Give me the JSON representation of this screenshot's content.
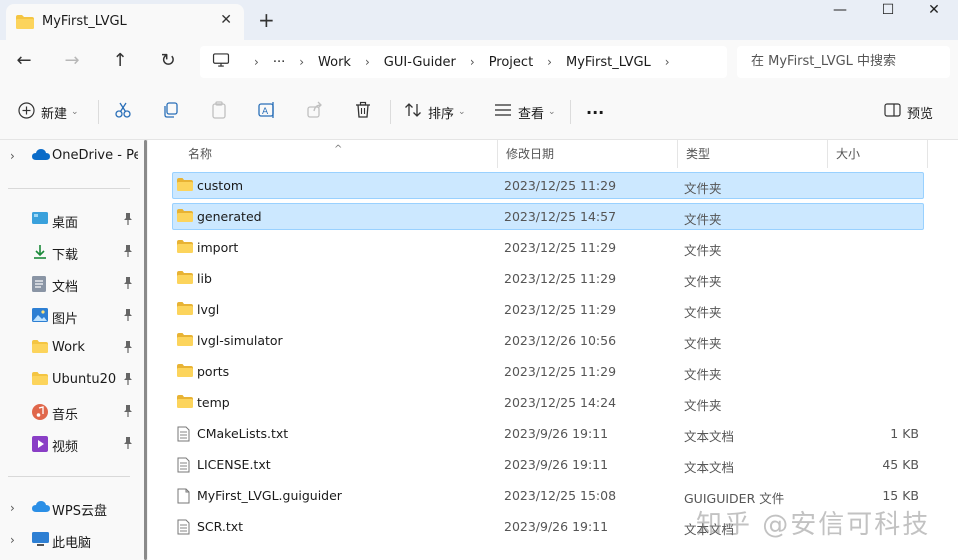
{
  "window": {
    "tab_title": "MyFirst_LVGL",
    "tab_close": "✕",
    "new_tab": "+",
    "minimize": "—",
    "maximize": "☐",
    "close": "✕"
  },
  "nav": {
    "back": "←",
    "forward": "→",
    "up": "↑",
    "refresh": "↻",
    "ellipsis": "···",
    "breadcrumbs": [
      "Work",
      "GUI-Guider",
      "Project",
      "MyFirst_LVGL"
    ],
    "search_placeholder": "在 MyFirst_LVGL 中搜索"
  },
  "commands": {
    "new_label": "新建",
    "sort_label": "排序",
    "view_label": "查看",
    "more": "···",
    "preview_label": "预览"
  },
  "sidebar": {
    "onedrive": "OneDrive - Per",
    "items": [
      {
        "label": "桌面",
        "icon": "desktop-icon"
      },
      {
        "label": "下载",
        "icon": "download-icon"
      },
      {
        "label": "文档",
        "icon": "document-icon"
      },
      {
        "label": "图片",
        "icon": "pictures-icon"
      },
      {
        "label": "Work",
        "icon": "folder-icon"
      },
      {
        "label": "Ubuntu20",
        "icon": "folder-icon"
      },
      {
        "label": "音乐",
        "icon": "music-icon"
      },
      {
        "label": "视频",
        "icon": "video-icon"
      }
    ],
    "wps": "WPS云盘",
    "this_pc": "此电脑"
  },
  "columns": {
    "name": "名称",
    "modified": "修改日期",
    "type": "类型",
    "size": "大小"
  },
  "files": [
    {
      "name": "custom",
      "date": "2023/12/25 11:29",
      "type": "文件夹",
      "size": "",
      "kind": "folder",
      "selected": true
    },
    {
      "name": "generated",
      "date": "2023/12/25 14:57",
      "type": "文件夹",
      "size": "",
      "kind": "folder",
      "selected": true
    },
    {
      "name": "import",
      "date": "2023/12/25 11:29",
      "type": "文件夹",
      "size": "",
      "kind": "folder",
      "selected": false
    },
    {
      "name": "lib",
      "date": "2023/12/25 11:29",
      "type": "文件夹",
      "size": "",
      "kind": "folder",
      "selected": false
    },
    {
      "name": "lvgl",
      "date": "2023/12/25 11:29",
      "type": "文件夹",
      "size": "",
      "kind": "folder",
      "selected": false
    },
    {
      "name": "lvgl-simulator",
      "date": "2023/12/26 10:56",
      "type": "文件夹",
      "size": "",
      "kind": "folder",
      "selected": false
    },
    {
      "name": "ports",
      "date": "2023/12/25 11:29",
      "type": "文件夹",
      "size": "",
      "kind": "folder",
      "selected": false
    },
    {
      "name": "temp",
      "date": "2023/12/25 14:24",
      "type": "文件夹",
      "size": "",
      "kind": "folder",
      "selected": false
    },
    {
      "name": "CMakeLists.txt",
      "date": "2023/9/26 19:11",
      "type": "文本文档",
      "size": "1 KB",
      "kind": "text",
      "selected": false
    },
    {
      "name": "LICENSE.txt",
      "date": "2023/9/26 19:11",
      "type": "文本文档",
      "size": "45 KB",
      "kind": "text",
      "selected": false
    },
    {
      "name": "MyFirst_LVGL.guiguider",
      "date": "2023/12/25 15:08",
      "type": "GUIGUIDER 文件",
      "size": "15 KB",
      "kind": "file",
      "selected": false
    },
    {
      "name": "SCR.txt",
      "date": "2023/9/26 19:11",
      "type": "文本文档",
      "size": "",
      "kind": "text",
      "selected": false
    }
  ],
  "watermark": "知乎 @安信可科技",
  "colors": {
    "folder": "#f4c542",
    "selection": "#cce8ff",
    "accent": "#0067c0"
  }
}
